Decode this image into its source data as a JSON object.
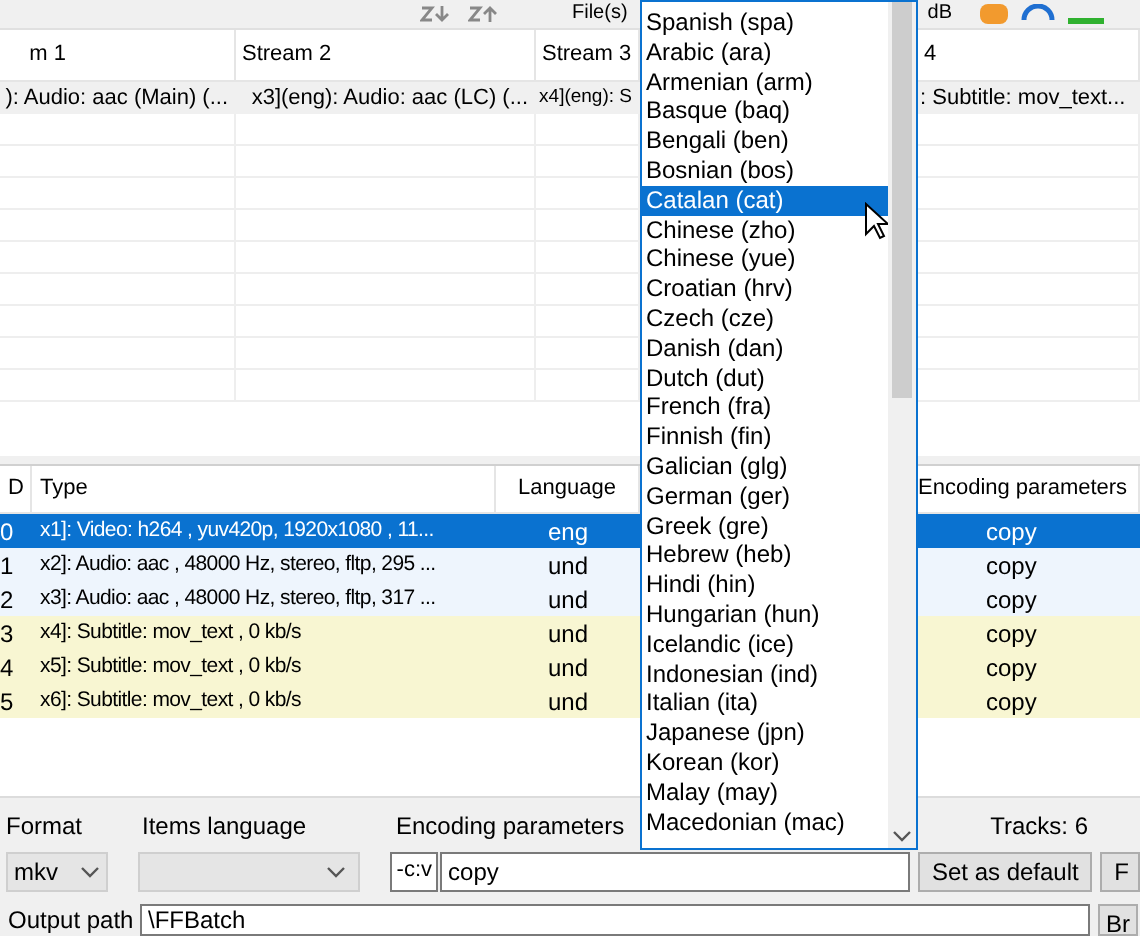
{
  "toolbar": {
    "files_label": "File(s)",
    "db_label": "dB"
  },
  "streams_table": {
    "columns": [
      "m 1",
      "Stream 2",
      "Stream 3",
      "4"
    ],
    "rows": [
      [
        "): Audio: aac (Main) (...",
        "x3](eng): Audio: aac (LC) (...",
        "x4](eng): S",
        ": Subtitle: mov_text..."
      ]
    ]
  },
  "tracks_table": {
    "columns": [
      "D",
      "Type",
      "Language",
      "Encoding parameters"
    ],
    "rows": [
      {
        "id": "0",
        "type": "x1]: Video: h264 , yuv420p, 1920x1080 , 11...",
        "language": "eng",
        "encoding": "copy",
        "kind": "video",
        "selected": true
      },
      {
        "id": "1",
        "type": "x2]: Audio: aac , 48000 Hz, stereo, fltp, 295 ...",
        "language": "und",
        "encoding": "copy",
        "kind": "audio",
        "selected": false
      },
      {
        "id": "2",
        "type": "x3]: Audio: aac , 48000 Hz, stereo, fltp, 317 ...",
        "language": "und",
        "encoding": "copy",
        "kind": "audio",
        "selected": false
      },
      {
        "id": "3",
        "type": "x4]: Subtitle: mov_text , 0 kb/s",
        "language": "und",
        "encoding": "copy",
        "kind": "subtitle",
        "selected": false
      },
      {
        "id": "4",
        "type": "x5]: Subtitle: mov_text , 0 kb/s",
        "language": "und",
        "encoding": "copy",
        "kind": "subtitle",
        "selected": false
      },
      {
        "id": "5",
        "type": "x6]: Subtitle: mov_text , 0 kb/s",
        "language": "und",
        "encoding": "copy",
        "kind": "subtitle",
        "selected": false
      }
    ]
  },
  "language_list": [
    {
      "label": "Spanish (spa)",
      "selected": false
    },
    {
      "label": "Arabic (ara)",
      "selected": false
    },
    {
      "label": "Armenian (arm)",
      "selected": false
    },
    {
      "label": "Basque (baq)",
      "selected": false
    },
    {
      "label": "Bengali (ben)",
      "selected": false
    },
    {
      "label": "Bosnian (bos)",
      "selected": false
    },
    {
      "label": "Catalan (cat)",
      "selected": true
    },
    {
      "label": "Chinese (zho)",
      "selected": false
    },
    {
      "label": "Chinese (yue)",
      "selected": false
    },
    {
      "label": "Croatian (hrv)",
      "selected": false
    },
    {
      "label": "Czech (cze)",
      "selected": false
    },
    {
      "label": "Danish (dan)",
      "selected": false
    },
    {
      "label": "Dutch (dut)",
      "selected": false
    },
    {
      "label": "French (fra)",
      "selected": false
    },
    {
      "label": "Finnish (fin)",
      "selected": false
    },
    {
      "label": "Galician (glg)",
      "selected": false
    },
    {
      "label": "German (ger)",
      "selected": false
    },
    {
      "label": "Greek (gre)",
      "selected": false
    },
    {
      "label": "Hebrew (heb)",
      "selected": false
    },
    {
      "label": "Hindi (hin)",
      "selected": false
    },
    {
      "label": "Hungarian (hun)",
      "selected": false
    },
    {
      "label": "Icelandic (ice)",
      "selected": false
    },
    {
      "label": "Indonesian (ind)",
      "selected": false
    },
    {
      "label": "Italian (ita)",
      "selected": false
    },
    {
      "label": "Japanese (jpn)",
      "selected": false
    },
    {
      "label": "Korean (kor)",
      "selected": false
    },
    {
      "label": "Malay (may)",
      "selected": false
    },
    {
      "label": "Macedonian (mac)",
      "selected": false
    }
  ],
  "bottom_panel": {
    "format_label": "Format",
    "format_value": "mkv",
    "items_language_label": "Items language",
    "encoding_label": "Encoding parameters",
    "codec_flag": "-c:v",
    "encoding_value": "copy",
    "tracks_count": "Tracks: 6",
    "set_default_button": "Set as default",
    "next_button": "F",
    "output_path_label": "Output path",
    "output_path_value": "\\FFBatch",
    "browse_button": "Br"
  }
}
